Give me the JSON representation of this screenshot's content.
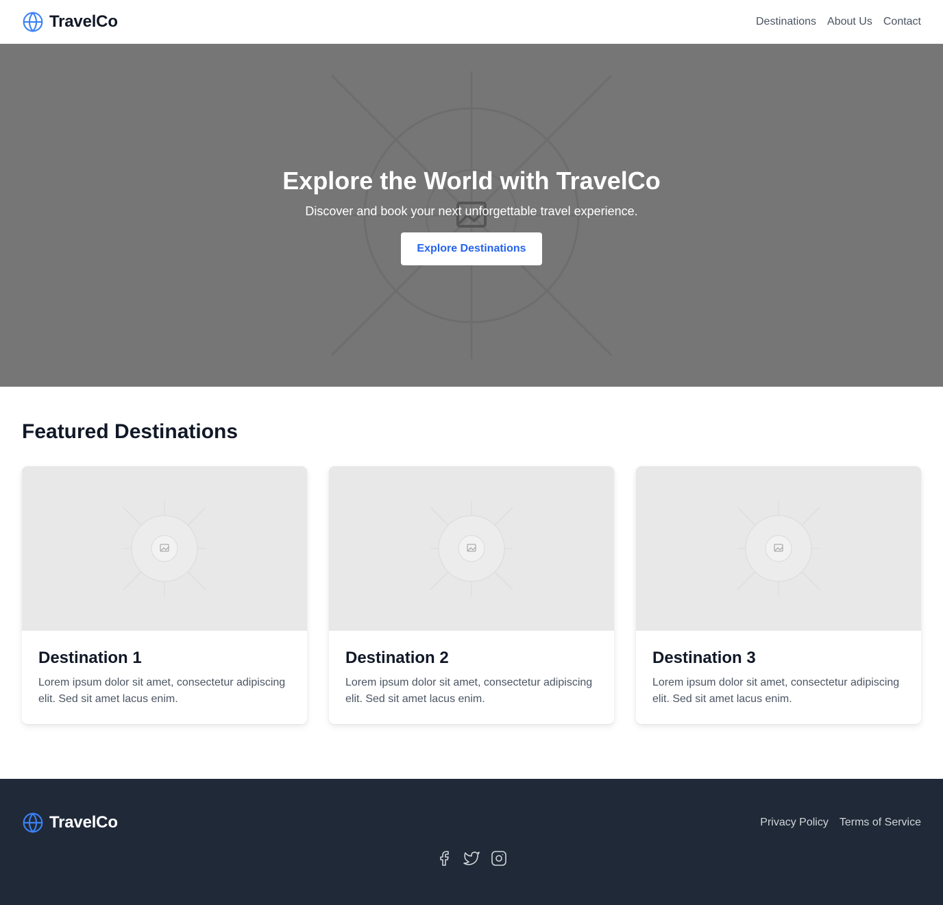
{
  "header": {
    "brand": "TravelCo",
    "nav": [
      "Destinations",
      "About Us",
      "Contact"
    ]
  },
  "hero": {
    "title": "Explore the World with TravelCo",
    "subtitle": "Discover and book your next unforgettable travel experience.",
    "button": "Explore Destinations"
  },
  "featured": {
    "title": "Featured Destinations",
    "cards": [
      {
        "title": "Destination 1",
        "text": "Lorem ipsum dolor sit amet, consectetur adipiscing elit. Sed sit amet lacus enim."
      },
      {
        "title": "Destination 2",
        "text": "Lorem ipsum dolor sit amet, consectetur adipiscing elit. Sed sit amet lacus enim."
      },
      {
        "title": "Destination 3",
        "text": "Lorem ipsum dolor sit amet, consectetur adipiscing elit. Sed sit amet lacus enim."
      }
    ]
  },
  "footer": {
    "brand": "TravelCo",
    "links": [
      "Privacy Policy",
      "Terms of Service"
    ],
    "social": [
      "facebook-icon",
      "twitter-icon",
      "instagram-icon"
    ]
  },
  "colors": {
    "accent": "#2563eb",
    "hero_bg": "#767676",
    "footer_bg": "#1f2937"
  }
}
